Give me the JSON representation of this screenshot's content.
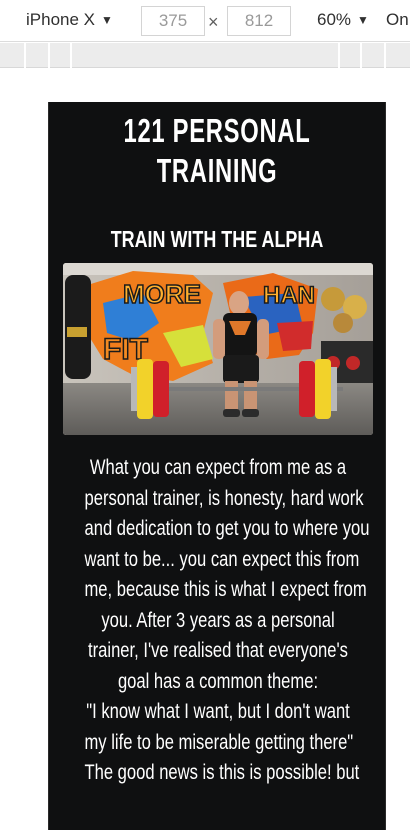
{
  "devtools": {
    "device": "iPhone X",
    "width_value": "375",
    "height_value": "812",
    "times_symbol": "×",
    "zoom": "60%",
    "throttle": "On"
  },
  "page": {
    "title_line1": "121 PERSONAL",
    "title_line2": "TRAINING",
    "subtitle": "TRAIN WITH THE ALPHA",
    "hero_image_alt": "Trainer deadlifting in a gym with graffiti wall",
    "body_lines": [
      "What you can expect from me as a",
      "personal trainer, is honesty, hard work",
      "and dedication to get you to where you",
      "want to be... you can expect this from",
      "me, because this is what I expect from",
      "you. After 3 years as a personal",
      "trainer, I've realised that everyone's",
      "goal has a common theme:",
      "\"I know what I want, but I don't want",
      "my life to be miserable getting there\"",
      "The good news is this is possible! but"
    ]
  },
  "colors": {
    "page_background": "#0f1011",
    "text": "#ffffff",
    "plate_yellow": "#f2d22a",
    "plate_red": "#d0202a"
  }
}
